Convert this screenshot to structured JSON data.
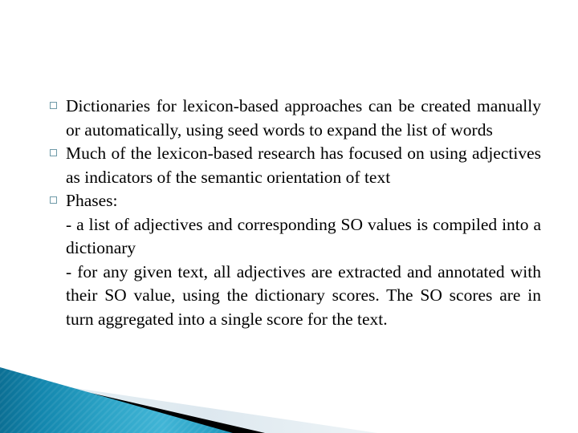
{
  "slide": {
    "background_color": "#ffffff",
    "text_color": "#000000",
    "bullet_color": "#6f9aa8",
    "bullet_glyph_name": "hollow-square-bullet"
  },
  "content": {
    "bullets": [
      {
        "marker": "square",
        "text": "Dictionaries for lexicon-based approaches can be created manually or automatically, using seed words to expand the list of words"
      },
      {
        "marker": "square",
        "text": "Much of the lexicon-based research has focused on using adjectives as indicators of the semantic orientation of text"
      },
      {
        "marker": "square",
        "text": "Phases:"
      }
    ],
    "sub_items": [
      {
        "marker": "-",
        "text": "- a list of adjectives and corresponding SO values is compiled into a dictionary"
      },
      {
        "marker": "-",
        "text": "- for any given text, all adjectives are extracted and annotated with their SO value, using the dictionary scores. The SO scores are in turn aggregated into a single score for the text."
      }
    ]
  },
  "decoration": {
    "name": "bottom-left-corner-accent",
    "teal_dark": "#0f7da3",
    "teal_light": "#3fb3d4",
    "teal_mid": "#1a92b8",
    "black_band": "#000000",
    "light_band": "#dde8ee"
  }
}
